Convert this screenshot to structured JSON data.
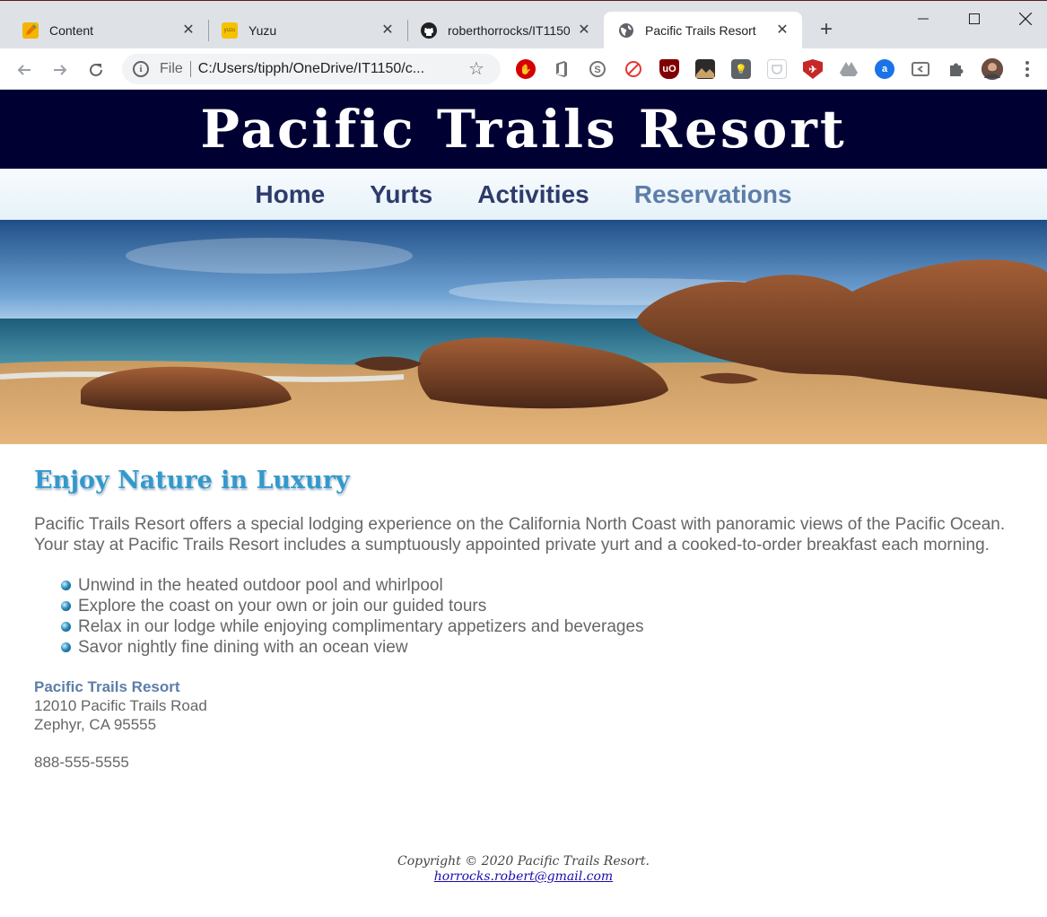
{
  "browser": {
    "tabs": [
      {
        "title": "Content",
        "icon": "edit-pencil-icon",
        "active": false
      },
      {
        "title": "Yuzu",
        "icon": "yuzu-logo-icon",
        "active": false
      },
      {
        "title": "roberthorrocks/IT1150",
        "icon": "github-icon",
        "active": false
      },
      {
        "title": "Pacific Trails Resort",
        "icon": "globe-icon",
        "active": true
      }
    ],
    "omnibox": {
      "scheme_label": "File",
      "url": "C:/Users/tipph/OneDrive/IT1150/c..."
    },
    "extension_icons": [
      "adblock-icon",
      "office-icon",
      "skype-icon",
      "no-spam-icon",
      "ublock-icon",
      "dark-image-icon",
      "idea-bulb-icon",
      "pocket-icon",
      "shield-extension-icon",
      "google-drive-icon",
      "amazon-assistant-icon",
      "cast-window-icon",
      "puzzle-extensions-icon"
    ]
  },
  "site": {
    "title": "Pacific Trails Resort",
    "nav": [
      {
        "label": "Home",
        "current": false
      },
      {
        "label": "Yurts",
        "current": false
      },
      {
        "label": "Activities",
        "current": false
      },
      {
        "label": "Reservations",
        "current": true
      }
    ],
    "heading": "Enjoy Nature in Luxury",
    "intro": "Pacific Trails Resort offers a special lodging experience on the California North Coast with panoramic views of the Pacific Ocean. Your stay at Pacific Trails Resort includes a sumptuously appointed private yurt and a cooked-to-order breakfast each morning.",
    "amenities": [
      "Unwind in the heated outdoor pool and whirlpool",
      "Explore the coast on your own or join our guided tours",
      "Relax in our lodge while enjoying complimentary appetizers and beverages",
      "Savor nightly fine dining with an ocean view"
    ],
    "contact": {
      "name": "Pacific Trails Resort",
      "street": "12010 Pacific Trails Road",
      "city": "Zephyr, CA 95555",
      "phone": "888-555-5555"
    },
    "footer": {
      "copyright": "Copyright © 2020 Pacific Trails Resort.",
      "email": "horrocks.robert@gmail.com"
    }
  },
  "colors": {
    "header_bg": "#000033",
    "heading": "#3399cc",
    "nav_link": "#2e3b6b",
    "nav_current": "#5c7ea8"
  }
}
